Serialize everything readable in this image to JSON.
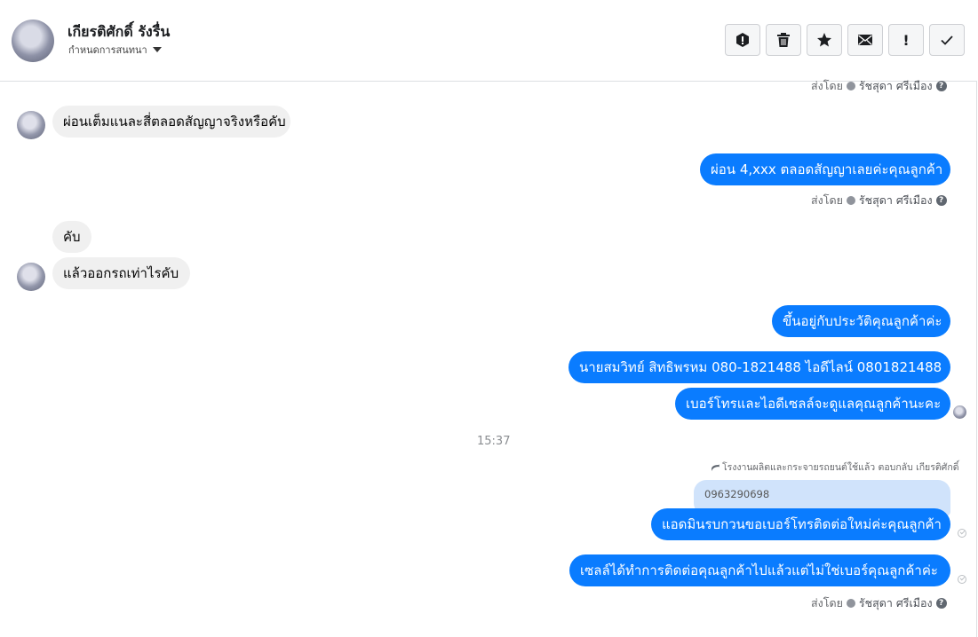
{
  "header": {
    "name": "เกียรติศักดิ์ รังรื่น",
    "subtitle": "กำหนดการสนทนา"
  },
  "actions": [
    {
      "icon": "alert-icon"
    },
    {
      "icon": "trash-icon"
    },
    {
      "icon": "star-icon"
    },
    {
      "icon": "mail-icon"
    },
    {
      "icon": "exclamation-icon",
      "text": "!"
    },
    {
      "icon": "check-icon"
    }
  ],
  "thread": {
    "sent_by_label": "ส่งโดย",
    "sender": "รัชสุดา ศรีเมือง",
    "messages": {
      "m1": "ผ่อนเต็มแนละสี่ตลอดสัญญาจริงหรือคับ",
      "m2": "ผ่อน 4,xxx ตลอดสัญญาเลยค่ะคุณลูกค้า",
      "m3": "คับ",
      "m4": "แล้วออกรถเท่าไรคับ",
      "m5": "ขึ้นอยู่กับประวัติคุณลูกค้าค่ะ",
      "m6": "นายสมวิทย์ สิทธิพรหม   080-1821488 ไอดีไลน์ 0801821488",
      "m7": "เบอร์โทรและไอดีเซลล์จะดูแลคุณลูกค้านะคะ",
      "m8": "แอดมินรบกวนขอเบอร์โทรติดต่อใหม่ค่ะคุณลูกค้า",
      "m9": "เซลล์ได้ทำการติดต่อคุณลูกค้าไปแล้วแต่ไม่ใช่เบอร์คุณลูกค้าค่ะ"
    },
    "time_divider": "15:37",
    "reply_note": "โรงงานผลิตและกระจายรถยนต์ใช้แล้ว ตอบกลับ เกียรติศักดิ์",
    "reply_quote": "0963290698"
  }
}
